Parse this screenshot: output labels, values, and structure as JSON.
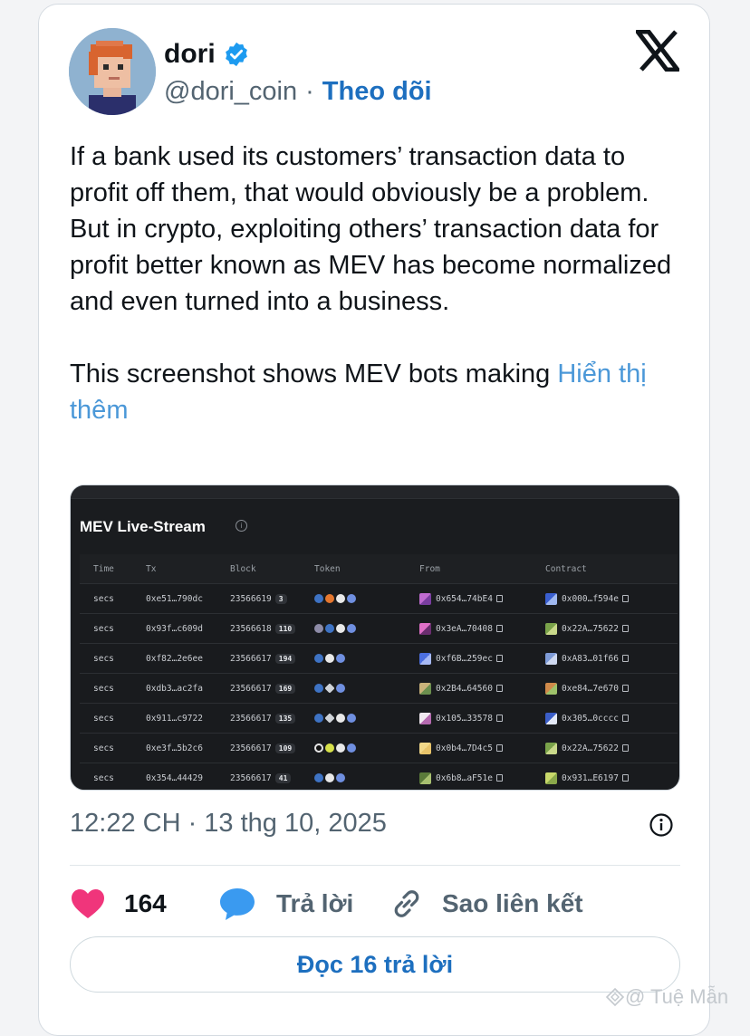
{
  "author": {
    "name": "dori",
    "handle": "@dori_coin",
    "separator": "·",
    "follow_label": "Theo dõi"
  },
  "tweet": {
    "paragraph_1": "If a bank used its customers’ transaction data to profit off them, that would obviously be a problem. But in crypto, exploiting others’ transaction data for profit better known as MEV has become normalized and even turned into a business.",
    "paragraph_2": "This screenshot shows MEV bots making ",
    "show_more": "Hiển thị thêm"
  },
  "media": {
    "title": "MEV Live-Stream",
    "info_glyph": "i",
    "columns": [
      "Time",
      "Tx",
      "Block",
      "Token",
      "From",
      "Contract"
    ],
    "rows": [
      {
        "time": "secs",
        "tx": "0xe51…790dc",
        "block": "23566619",
        "count": "3",
        "from": "0x654…74bE4",
        "contract": "0x000…f594e"
      },
      {
        "time": "secs",
        "tx": "0x93f…c609d",
        "block": "23566618",
        "count": "110",
        "from": "0x3eA…70408",
        "contract": "0x22A…75622"
      },
      {
        "time": "secs",
        "tx": "0xf82…2e6ee",
        "block": "23566617",
        "count": "194",
        "from": "0xf6B…259ec",
        "contract": "0xA83…01f66"
      },
      {
        "time": "secs",
        "tx": "0xdb3…ac2fa",
        "block": "23566617",
        "count": "169",
        "from": "0x2B4…64560",
        "contract": "0xe84…7e670"
      },
      {
        "time": "secs",
        "tx": "0x911…c9722",
        "block": "23566617",
        "count": "135",
        "from": "0x105…33578",
        "contract": "0x305…0cccc"
      },
      {
        "time": "secs",
        "tx": "0xe3f…5b2c6",
        "block": "23566617",
        "count": "109",
        "from": "0x0b4…7D4c5",
        "contract": "0x22A…75622"
      },
      {
        "time": "secs",
        "tx": "0x354…44429",
        "block": "23566617",
        "count": "41",
        "from": "0x6b8…aF51e",
        "contract": "0x931…E6197"
      }
    ]
  },
  "timestamp": "12:22 CH · 13 thg 10, 2025",
  "actions": {
    "like_count": "164",
    "reply_label": "Trả lời",
    "copy_link_label": "Sao liên kết"
  },
  "read_replies_label": "Đọc 16 trả lời",
  "watermark": "@ Tuệ Mẫn",
  "colors": {
    "accent": "#1d6fbf",
    "link": "#4b98d8",
    "like": "#f0357b",
    "reply": "#3a9af0",
    "verified": "#1d9bf0"
  }
}
